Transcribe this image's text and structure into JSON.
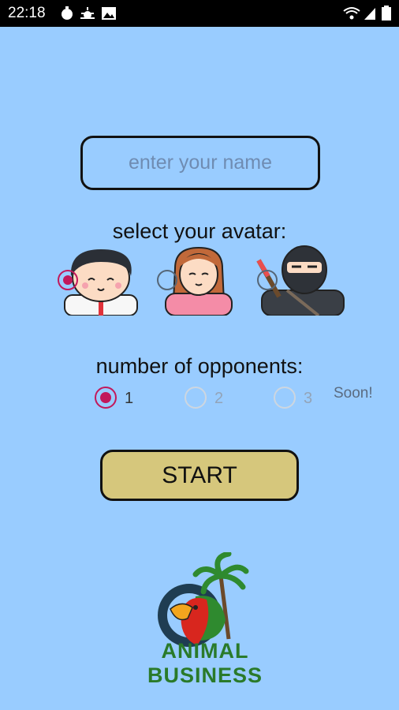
{
  "status_bar": {
    "time": "22:18",
    "left_icons": [
      "timer-icon",
      "weather-icon",
      "image-icon"
    ],
    "right_icons": [
      "wifi-icon",
      "signal-icon",
      "battery-icon"
    ]
  },
  "name_field": {
    "placeholder": "enter your name",
    "value": ""
  },
  "avatar_section": {
    "label": "select your avatar:",
    "avatars": [
      {
        "name": "boy-avatar",
        "selected": true
      },
      {
        "name": "girl-avatar",
        "selected": false
      },
      {
        "name": "ninja-avatar",
        "selected": false
      }
    ]
  },
  "opponents": {
    "label": "number of opponents:",
    "options": [
      {
        "label": "1",
        "checked": true,
        "enabled": true
      },
      {
        "label": "2",
        "checked": false,
        "enabled": false
      },
      {
        "label": "3",
        "checked": false,
        "enabled": false
      }
    ],
    "soon_note": "Soon!"
  },
  "start_button": {
    "label": "START"
  },
  "logo": {
    "text": "ANIMAL BUSINESS"
  },
  "colors": {
    "background": "#99ccff",
    "accent": "#c2185b",
    "button": "#d6c77c",
    "logo_text": "#2a7a2a"
  }
}
